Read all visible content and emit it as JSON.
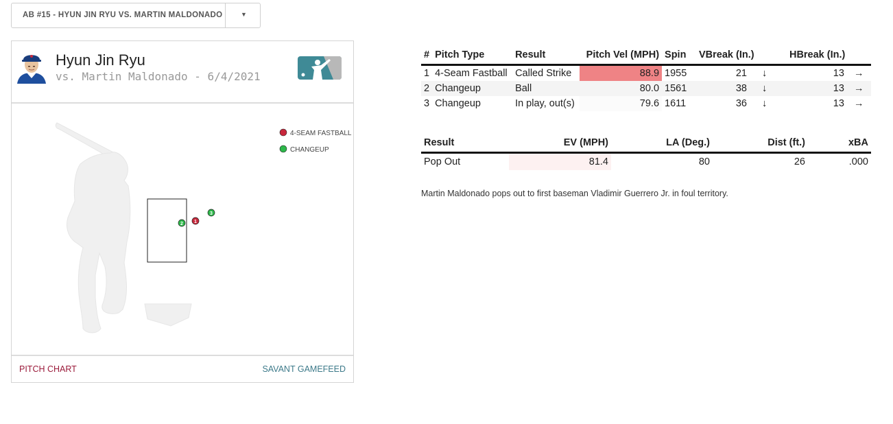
{
  "selector": {
    "label": "AB #15 - HYUN JIN RYU VS. MARTIN MALDONADO",
    "caret": "▼"
  },
  "card": {
    "pitcher_name": "Hyun Jin Ryu",
    "subline": "vs. Martin Maldonado - 6/4/2021",
    "legend": [
      {
        "label": "4-SEAM FASTBALL",
        "color": "#c8283c"
      },
      {
        "label": "CHANGEUP",
        "color": "#2db84a"
      }
    ],
    "footer_left": "PITCH CHART",
    "footer_right": "SAVANT GAMEFEED"
  },
  "pitches_chart": [
    {
      "number": "2",
      "type": "CHANGEUP",
      "color": "#2db84a"
    },
    {
      "number": "1",
      "type": "4-SEAM FASTBALL",
      "color": "#c8283c"
    },
    {
      "number": "3",
      "type": "CHANGEUP",
      "color": "#2db84a"
    }
  ],
  "pitch_table": {
    "headers": [
      "#",
      "Pitch Type",
      "Result",
      "Pitch Vel (MPH)",
      "Spin",
      "VBreak (In.)",
      "HBreak (In.)"
    ],
    "rows": [
      {
        "n": "1",
        "type": "4-Seam Fastball",
        "result": "Called Strike",
        "vel": "88.9",
        "spin": "1955",
        "vbreak": "21",
        "vdir": "↓",
        "hbreak": "13",
        "hdir": "→"
      },
      {
        "n": "2",
        "type": "Changeup",
        "result": "Ball",
        "vel": "80.0",
        "spin": "1561",
        "vbreak": "38",
        "vdir": "↓",
        "hbreak": "13",
        "hdir": "→"
      },
      {
        "n": "3",
        "type": "Changeup",
        "result": "In play, out(s)",
        "vel": "79.6",
        "spin": "1611",
        "vbreak": "36",
        "vdir": "↓",
        "hbreak": "13",
        "hdir": "→"
      }
    ]
  },
  "bip_table": {
    "headers": [
      "Result",
      "EV (MPH)",
      "LA (Deg.)",
      "Dist (ft.)",
      "xBA"
    ],
    "row": {
      "result": "Pop Out",
      "ev": "81.4",
      "la": "80",
      "dist": "26",
      "xba": ".000"
    }
  },
  "description": "Martin Maldonado pops out to first baseman Vladimir Guerrero Jr. in foul territory."
}
